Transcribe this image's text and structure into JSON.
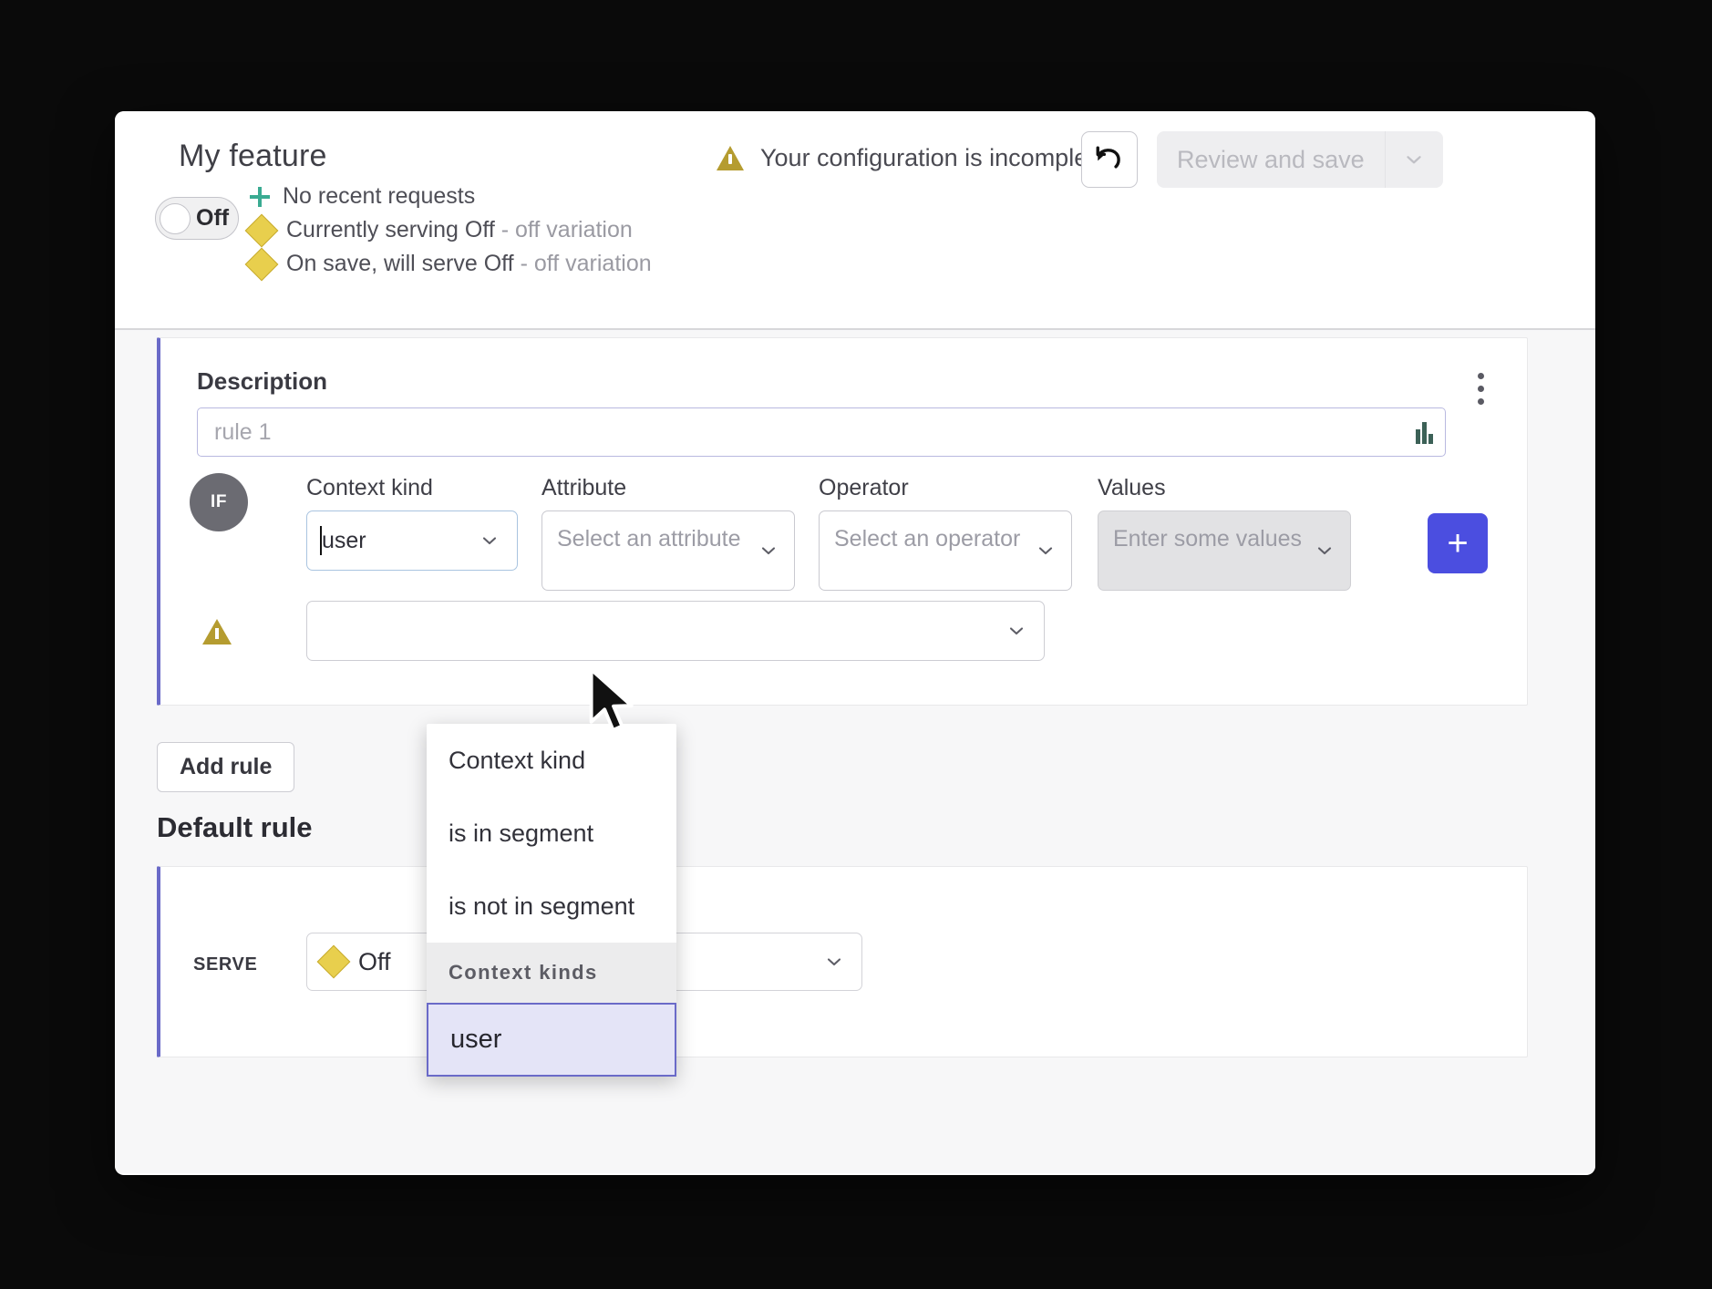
{
  "header": {
    "title": "My feature",
    "warning_text": "Your configuration is incomplete",
    "warning_icon": "warning-triangle-icon",
    "undo_icon": "undo-arrow-icon",
    "review_save_label": "Review and save",
    "review_save_caret_icon": "chevron-down-icon",
    "toggle_label": "Off",
    "status": [
      {
        "icon": "plus-icon",
        "text": "No recent requests",
        "muted": ""
      },
      {
        "icon": "diamond-icon",
        "text": "Currently serving Off",
        "muted": " - off variation"
      },
      {
        "icon": "diamond-icon",
        "text": "On save, will serve Off",
        "muted": " - off variation"
      }
    ]
  },
  "rule": {
    "description_label": "Description",
    "description_placeholder": "rule 1",
    "description_value": "",
    "kebab_icon": "kebab-menu-icon",
    "resize_icon": "resize-handle-icon",
    "if_badge": "IF",
    "fields": {
      "context_kind_label": "Context kind",
      "context_kind_value": "user",
      "attribute_label": "Attribute",
      "attribute_placeholder": "Select an attribute",
      "operator_label": "Operator",
      "operator_placeholder": "Select an operator",
      "values_label": "Values",
      "values_placeholder": "Enter some values"
    },
    "add_condition_label": "+",
    "second_row_warning_icon": "warning-triangle-icon",
    "second_row_value": ""
  },
  "actions": {
    "add_rule_label": "Add rule",
    "default_rule_heading": "Default rule"
  },
  "default_rule": {
    "serve_label": "SERVE",
    "variation_icon": "diamond-icon",
    "variation_value": "Off"
  },
  "dropdown": {
    "options": [
      {
        "label": "Context kind"
      },
      {
        "label": "is in segment"
      },
      {
        "label": "is not in segment"
      }
    ],
    "group_label": "Context kinds",
    "selected_option": "user"
  },
  "colors": {
    "accent_indigo": "#4b4ee0",
    "rule_border_purple": "#6a6ac8",
    "warning_gold": "#b59c30",
    "variation_diamond": "#e8cf4d",
    "plus_teal": "#3aab92",
    "selected_bg": "#e4e4f7"
  },
  "cursor": {
    "icon": "mouse-pointer-icon"
  }
}
